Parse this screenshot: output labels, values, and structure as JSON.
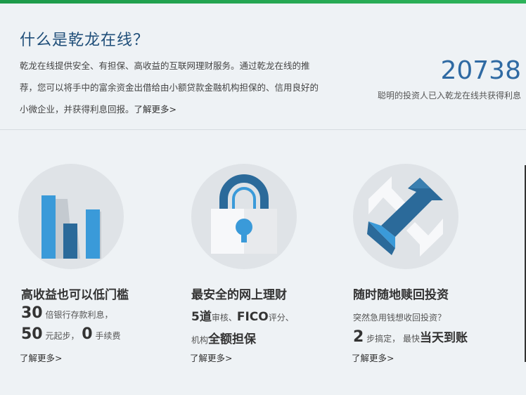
{
  "intro": {
    "title": "什么是乾龙在线？",
    "lines": [
      "乾龙在线提供安全、有担保、高收益的互联网理财服务。通过乾龙在线的推",
      "荐，您可以将手中的富余资金出借给由小额贷款金融机构担保的、信用良好的",
      "小微企业，并获得利息回报。"
    ],
    "more_link": "了解更多>"
  },
  "counter": {
    "number": "20738",
    "caption": "聪明的投资人已入乾龙在线共获得利息"
  },
  "features": [
    {
      "icon": "bar-chart-icon",
      "title": "高收益也可以低门槛",
      "l1_big": "30",
      "l1_text": "倍银行存款利息，",
      "l2_big_a": "50",
      "l2_text_a": "元起步，",
      "l2_big_b": "0",
      "l2_text_b": "手续费",
      "more": "了解更多>"
    },
    {
      "icon": "padlock-icon",
      "title": "最安全的网上理财",
      "l1_mid_a": "5道",
      "l1_text_a": "审核、",
      "l1_mid_b": "FICO",
      "l1_text_b": "评分、",
      "l2_text": "机构",
      "l2_mid": "全额担保",
      "more": "了解更多>"
    },
    {
      "icon": "exchange-arrows-icon",
      "title": "随时随地赎回投资",
      "l1_text": "突然急用钱想收回投资？",
      "l2_big": "2",
      "l2_text_a": "步搞定，",
      "l2_text_b": "最快",
      "l2_mid": "当天到账",
      "more": "了解更多>"
    }
  ],
  "colors": {
    "accent_blue": "#2f6aa3",
    "icon_blue": "#3a9ad9",
    "icon_dark_blue": "#2b6a9a",
    "top_bar_green": "#1c9a4a",
    "circle_bg": "#dfe3e7"
  }
}
